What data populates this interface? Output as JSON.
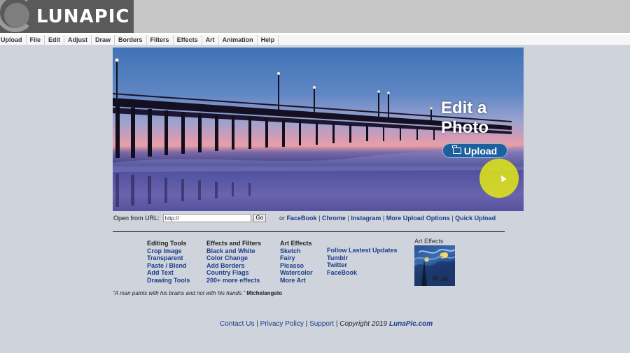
{
  "brand": {
    "logo_text": "LUNAPIC"
  },
  "menu": [
    "Upload",
    "File",
    "Edit",
    "Adjust",
    "Draw",
    "Borders",
    "Filters",
    "Effects",
    "Art",
    "Animation",
    "Help"
  ],
  "hero": {
    "title": "Edit a\nPhoto",
    "upload_label": "Upload"
  },
  "url_row": {
    "label": "Open from URL:",
    "input_value": "http://",
    "go_label": "Go",
    "prefix": "or",
    "links": [
      "FaceBook",
      "Chrome",
      "Instagram",
      "More Upload Options",
      "Quick Upload"
    ]
  },
  "columns": {
    "editing": {
      "title": "Editing Tools",
      "items": [
        "Crop Image",
        "Transparent",
        "Paste / Blend",
        "Add Text",
        "Drawing Tools"
      ]
    },
    "effects": {
      "title": "Effects and Filters",
      "items": [
        "Black and White",
        "Color Change",
        "Add Borders",
        "Country Flags",
        "200+ more effects"
      ]
    },
    "art": {
      "title": "Art Effects",
      "items": [
        "Sketch",
        "Fairy",
        "Picasso",
        "Watercolor",
        "More Art"
      ]
    },
    "follow": {
      "items": [
        "Follow Lastest Updates",
        "Tumblr",
        "Twitter",
        "FaceBook"
      ]
    }
  },
  "art_effects_label": "Art Effects",
  "quote": {
    "text": "\"A man paints with his brains and not with his hands.\"",
    "author": "Michelangelo"
  },
  "footer": {
    "contact": "Contact Us",
    "privacy": "Privacy Policy",
    "support": "Support",
    "copyright": "Copyright 2019",
    "brand": "LunaPic.com"
  }
}
